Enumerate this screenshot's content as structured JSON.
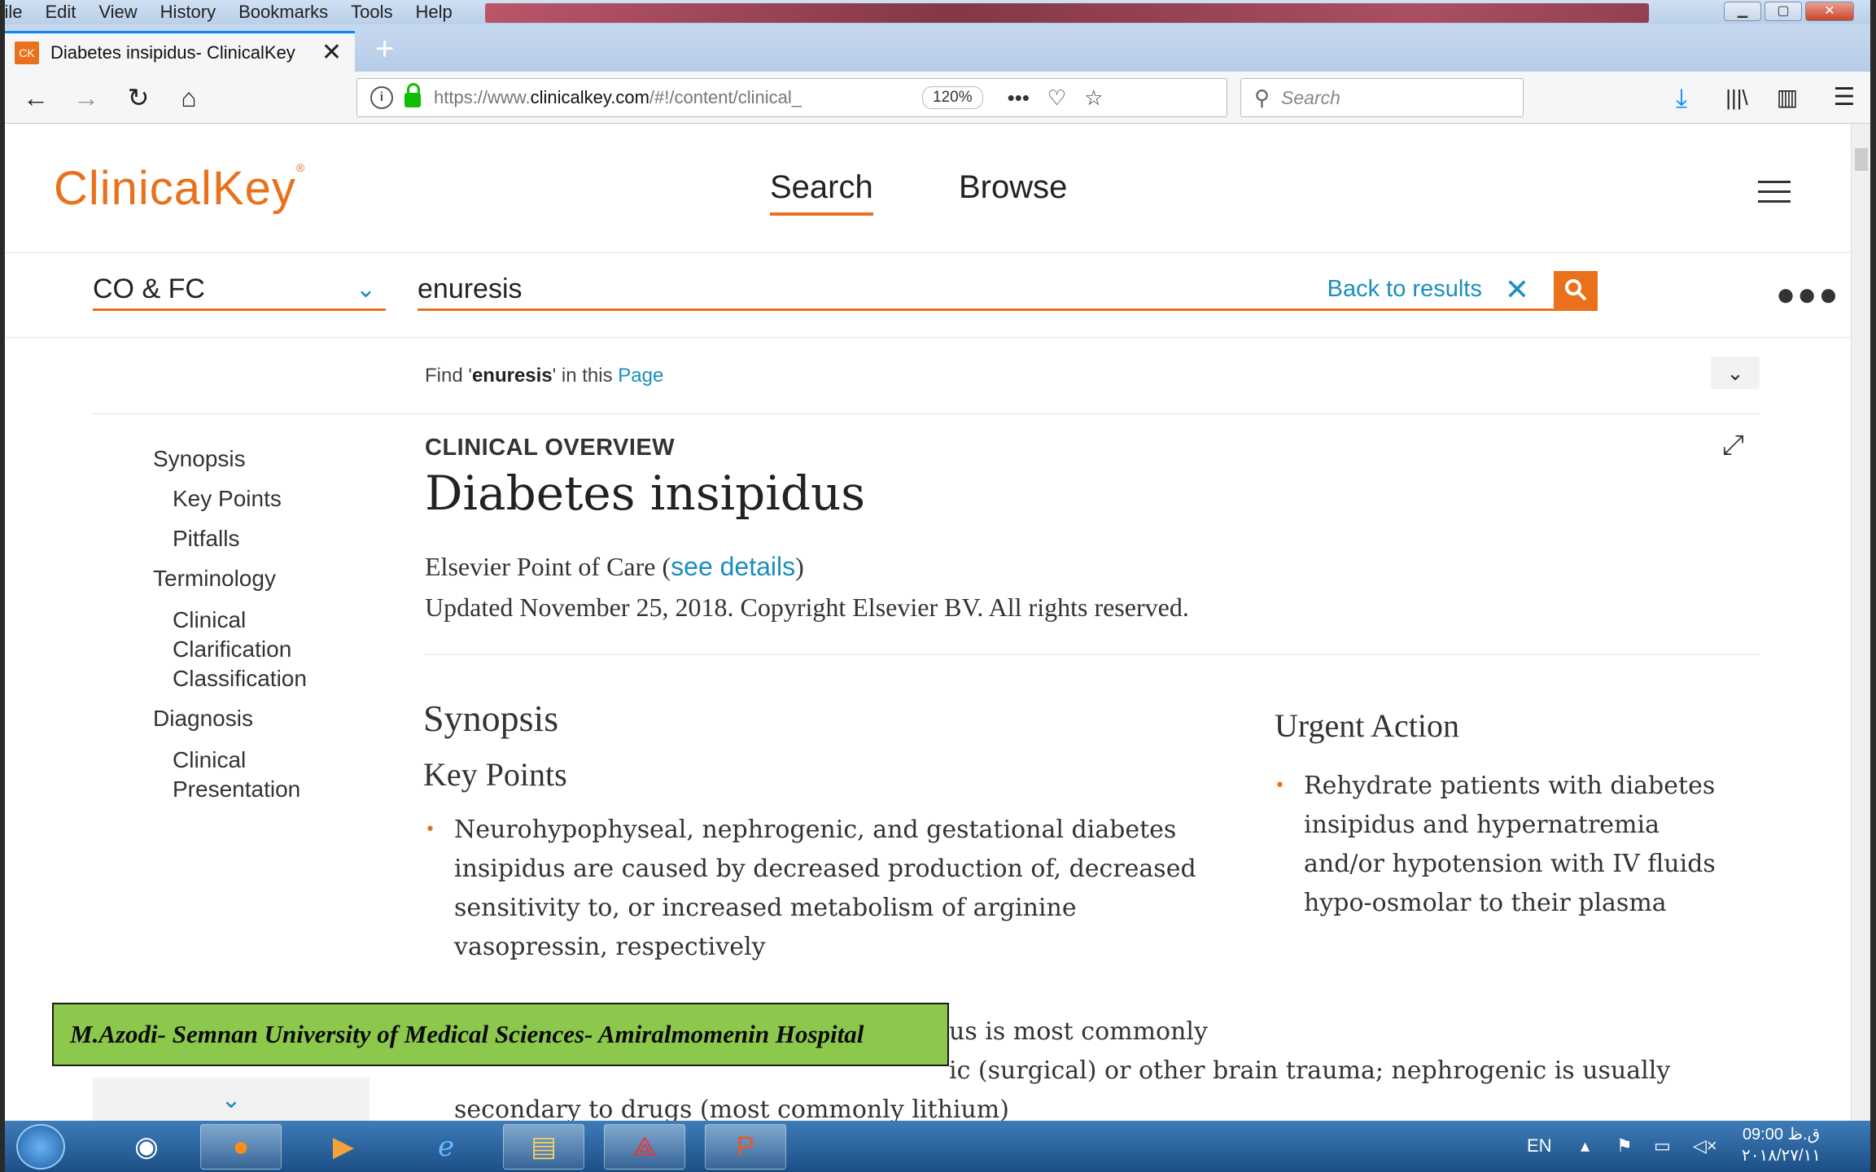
{
  "browser": {
    "menu": [
      "File",
      "Edit",
      "View",
      "History",
      "Bookmarks",
      "Tools",
      "Help"
    ],
    "tab_title": "Diabetes insipidus- ClinicalKey",
    "tab_favicon": "CK",
    "new_tab": "+",
    "url_prefix": "https://www.",
    "url_domain": "clinicalkey.com",
    "url_rest": "/#!/content/clinical_",
    "zoom": "120%",
    "search_placeholder": "Search"
  },
  "site": {
    "logo": "ClinicalKey",
    "logo_mark": "®",
    "nav": [
      "Search",
      "Browse"
    ],
    "filter_value": "CO & FC",
    "query": "enuresis",
    "back_to_results": "Back to results",
    "find_prefix": "Find '",
    "find_term": "enuresis",
    "find_mid": "' in this ",
    "find_link": "Page"
  },
  "toc": [
    {
      "label": "Synopsis",
      "level": 1
    },
    {
      "label": "Key Points",
      "level": 2
    },
    {
      "label": "Pitfalls",
      "level": 2
    },
    {
      "label": "Terminology",
      "level": 1
    },
    {
      "label": "Clinical Clarification",
      "level": 2
    },
    {
      "label": "Classification",
      "level": 2
    },
    {
      "label": "Diagnosis",
      "level": 1
    },
    {
      "label": "Clinical Presentation",
      "level": 2
    }
  ],
  "article": {
    "kicker": "CLINICAL OVERVIEW",
    "title": "Diabetes insipidus",
    "source": "Elsevier Point of Care (",
    "source_link": "see details",
    "source_close": ")",
    "updated": "Updated November 25, 2018. Copyright Elsevier BV. All rights reserved.",
    "synopsis_heading": "Synopsis",
    "key_points_heading": "Key Points",
    "key_point_1": "Neurohypophyseal, nephrogenic, and gestational diabetes insipidus are caused by decreased production of, decreased sensitivity to, or increased metabolism of arginine vasopressin, respectively",
    "key_point_2_a": "us is most commonly",
    "key_point_2_b": "ic (surgical) or other brain trauma; nephrogenic is usually",
    "key_point_2_c": "secondary to drugs (most commonly lithium)",
    "urgent_heading": "Urgent Action",
    "urgent_1": "Rehydrate patients with diabetes insipidus and hypernatremia and/or hypotension with IV fluids hypo-osmolar to their plasma"
  },
  "overlay_banner": "M.Azodi- Semnan University of  Medical Sciences- Amiralmomenin Hospital",
  "taskbar": {
    "lang": "EN",
    "time": "09:00 ق.ظ",
    "date": "۲۰۱۸/۲۷/۱۱"
  },
  "colors": {
    "accent": "#e9711c",
    "link": "#1a8fbe",
    "banner": "#8cc84b"
  }
}
